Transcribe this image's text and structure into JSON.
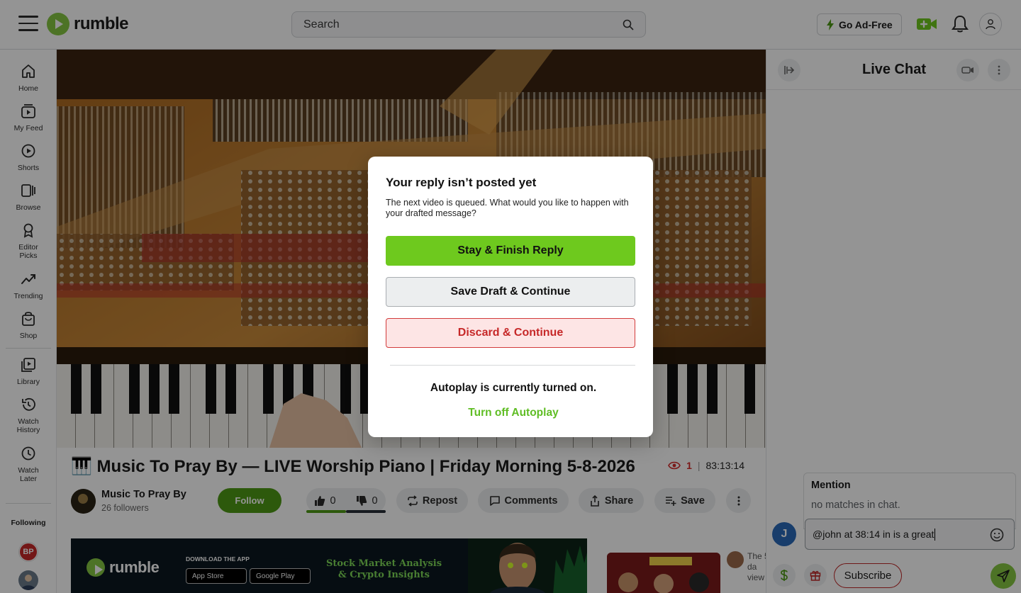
{
  "header": {
    "logo_text": "rumble",
    "search_placeholder": "Search",
    "go_ad_free_label": "Go Ad-Free"
  },
  "nav": {
    "items": [
      {
        "label": "Home",
        "icon": "home-icon"
      },
      {
        "label": "My Feed",
        "icon": "feed-icon"
      },
      {
        "label": "Shorts",
        "icon": "shorts-icon"
      },
      {
        "label": "Browse",
        "icon": "browse-icon"
      },
      {
        "label": "Editor Picks",
        "icon": "award-icon"
      },
      {
        "label": "Trending",
        "icon": "trending-icon"
      },
      {
        "label": "Shop",
        "icon": "shop-icon"
      },
      {
        "label": "Library",
        "icon": "library-icon"
      },
      {
        "label": "Watch History",
        "icon": "history-icon"
      },
      {
        "label": "Watch Later",
        "icon": "clock-icon"
      }
    ],
    "following_title": "Following",
    "following_avatar_text": "BP"
  },
  "video": {
    "title": "🎹 Music To Pray By — LIVE Worship Piano | Friday Morning 5-8-2026",
    "viewers": "1",
    "duration": "83:13:14",
    "channel_name": "Music To Pray By",
    "followers": "26 followers",
    "follow_label": "Follow",
    "likes": "0",
    "dislikes": "0",
    "repost_label": "Repost",
    "comments_label": "Comments",
    "share_label": "Share",
    "save_label": "Save"
  },
  "ad": {
    "logo_text": "rumble",
    "download_text": "DOWNLOAD THE APP",
    "app_store": "App Store",
    "google_play": "Google Play",
    "headline_line1": "Stock Market Analysis",
    "headline_line2": "& Crypto Insights"
  },
  "sidebar_video": {
    "text": "The 5 da view"
  },
  "chat": {
    "title": "Live Chat",
    "mention_title": "Mention",
    "mention_empty": "no matches in chat.",
    "user_initial": "J",
    "input_value": "@john at 38:14 in is a great",
    "subscribe_label": "Subscribe"
  },
  "modal": {
    "title": "Your reply isn’t posted yet",
    "description": "The next video is queued. What would you like to happen with your drafted message?",
    "primary_label": "Stay & Finish Reply",
    "secondary_label": "Save Draft & Continue",
    "danger_label": "Discard & Continue",
    "autoplay_status": "Autoplay is currently turned on.",
    "autoplay_link": "Turn off Autoplay"
  },
  "colors": {
    "brand_green": "#85c742",
    "primary_button": "#6ec91e",
    "danger": "#d23b3b",
    "follow_button": "#4e9a15"
  }
}
